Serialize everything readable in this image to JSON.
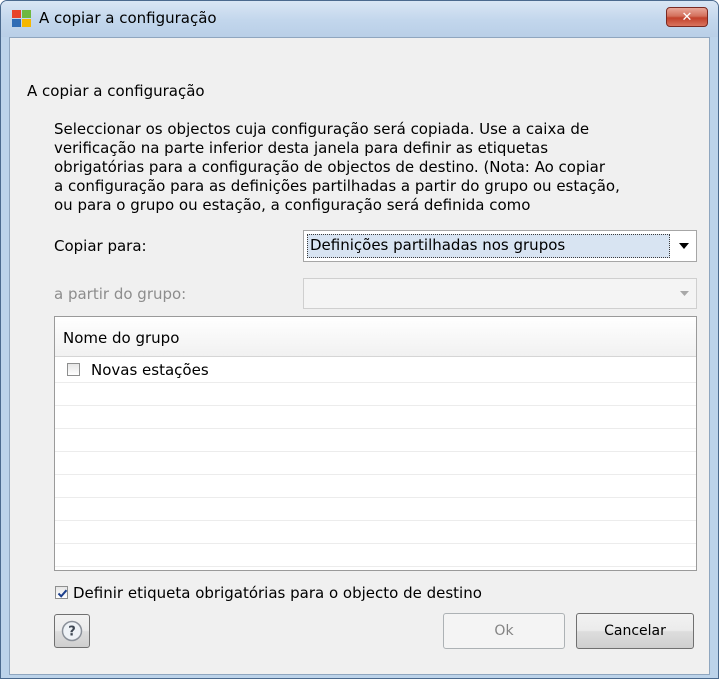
{
  "window": {
    "title": "A copiar a configuração",
    "app_icon": "avg-logo-icon",
    "close_icon": "close-icon",
    "close_glyph": "✕"
  },
  "dialog": {
    "heading": "A copiar a configuração",
    "description_lines": [
      "Seleccionar os objectos cuja configuração será copiada. Use a caixa de",
      "verificação na parte inferior desta janela para definir as etiquetas",
      "obrigatórias para a configuração de objectos de destino. (Nota: Ao copiar",
      "a configuração para as definições partilhadas a partir do grupo ou estação,",
      "ou para o grupo ou estação, a configuração será definida como"
    ],
    "copy_to": {
      "label": "Copiar para:",
      "value": "Definições partilhadas nos grupos",
      "arrow_icon": "dropdown-arrow-icon"
    },
    "from_group": {
      "label": "a partir do grupo:",
      "value": "",
      "disabled": true,
      "arrow_icon": "dropdown-arrow-icon"
    },
    "group_list": {
      "column_header": "Nome do grupo",
      "rows": [
        {
          "label": "Novas estações",
          "checked": false
        }
      ]
    },
    "mandatory_checkbox": {
      "label": "Definir etiqueta obrigatórias para o objecto de destino",
      "checked": true
    },
    "buttons": {
      "help_icon": "help-icon",
      "help_glyph": "?",
      "ok": "Ok",
      "cancel": "Cancelar"
    }
  },
  "colors": {
    "titlebar": "#c2d6ec",
    "close_button": "#c2412b",
    "dialog_background": "#f0f0f0",
    "disabled_text": "#8d8d8d",
    "check_mark": "#1c3f8c"
  }
}
